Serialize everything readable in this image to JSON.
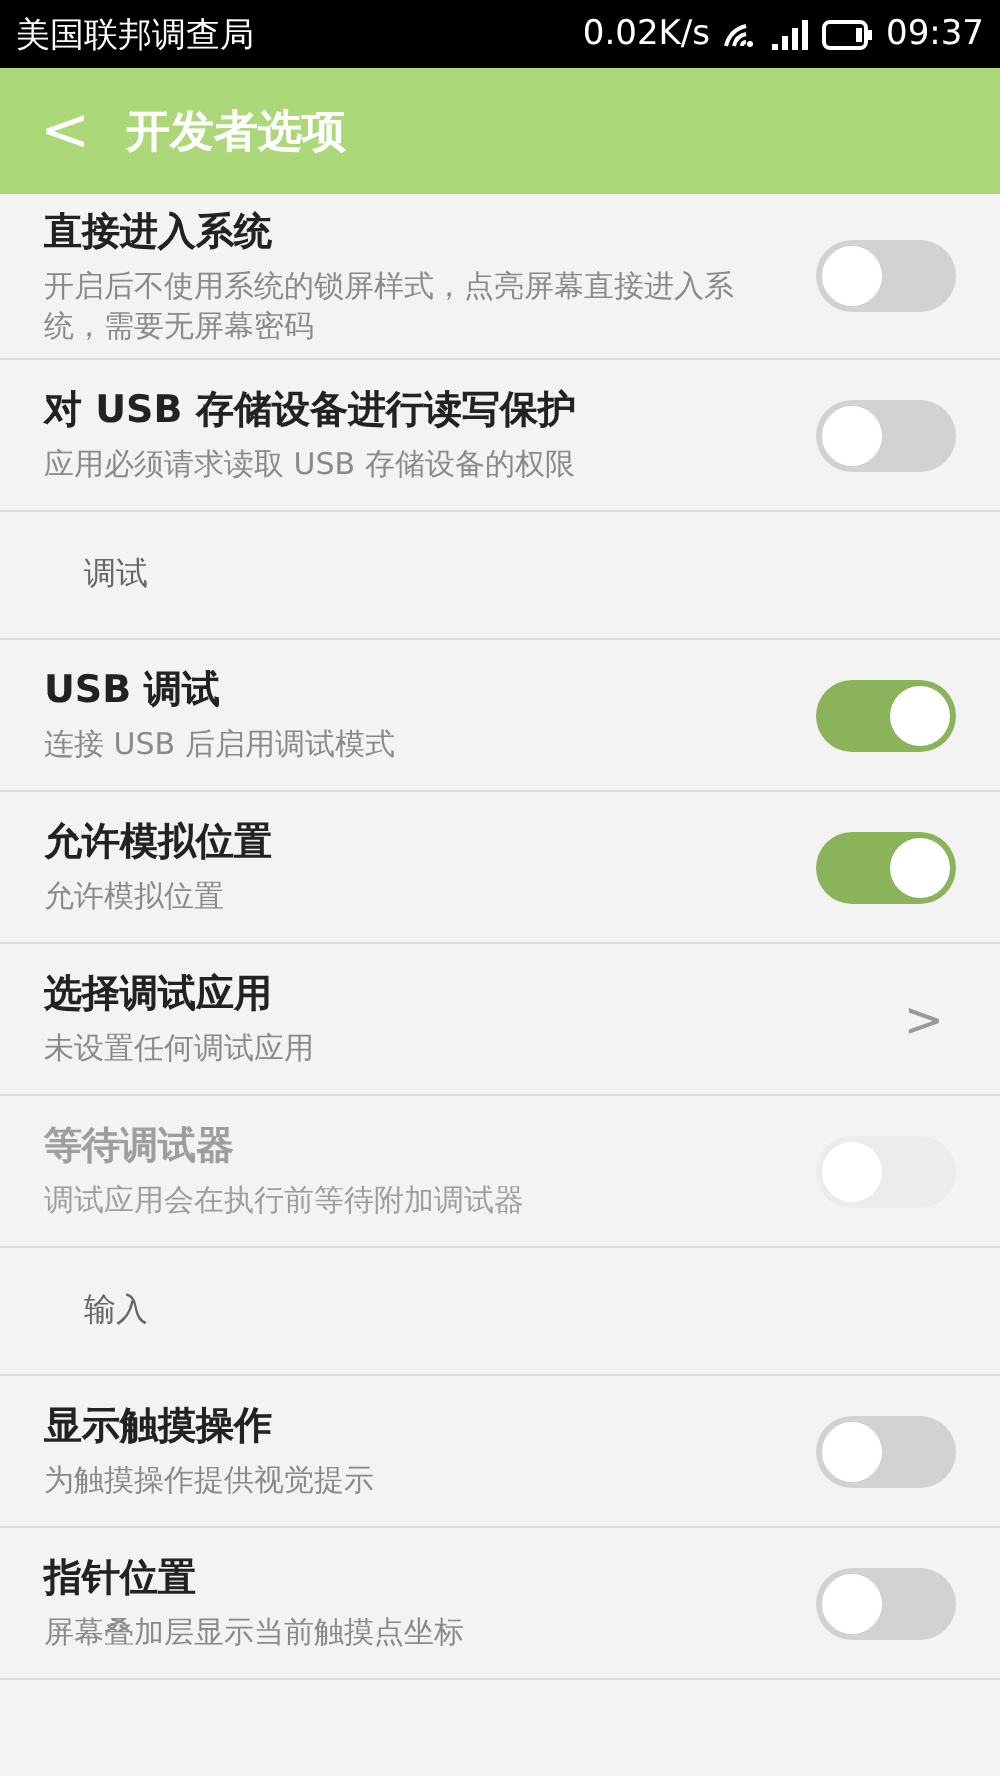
{
  "status_bar": {
    "carrier": "美国联邦调查局",
    "speed": "0.02K/s",
    "time": "09:37"
  },
  "header": {
    "back": "<",
    "title": "开发者选项"
  },
  "items": [
    {
      "kind": "toggle",
      "title": "直接进入系统",
      "subtitle": "开启后不使用系统的锁屏样式，点亮屏幕直接进入系统，需要无屏幕密码",
      "on": false,
      "disabled": false
    },
    {
      "kind": "toggle",
      "title": "对 USB 存储设备进行读写保护",
      "subtitle": "应用必须请求读取 USB 存储设备的权限",
      "on": false,
      "disabled": false
    },
    {
      "kind": "section",
      "title": "调试"
    },
    {
      "kind": "toggle",
      "title": "USB 调试",
      "subtitle": "连接 USB 后启用调试模式",
      "on": true,
      "disabled": false
    },
    {
      "kind": "toggle",
      "title": "允许模拟位置",
      "subtitle": "允许模拟位置",
      "on": true,
      "disabled": false
    },
    {
      "kind": "link",
      "title": "选择调试应用",
      "subtitle": "未设置任何调试应用",
      "chevron": ">"
    },
    {
      "kind": "toggle",
      "title": "等待调试器",
      "subtitle": "调试应用会在执行前等待附加调试器",
      "on": false,
      "disabled": true
    },
    {
      "kind": "section",
      "title": "输入"
    },
    {
      "kind": "toggle",
      "title": "显示触摸操作",
      "subtitle": "为触摸操作提供视觉提示",
      "on": false,
      "disabled": false
    },
    {
      "kind": "toggle",
      "title": "指针位置",
      "subtitle": "屏幕叠加层显示当前触摸点坐标",
      "on": false,
      "disabled": false
    }
  ]
}
